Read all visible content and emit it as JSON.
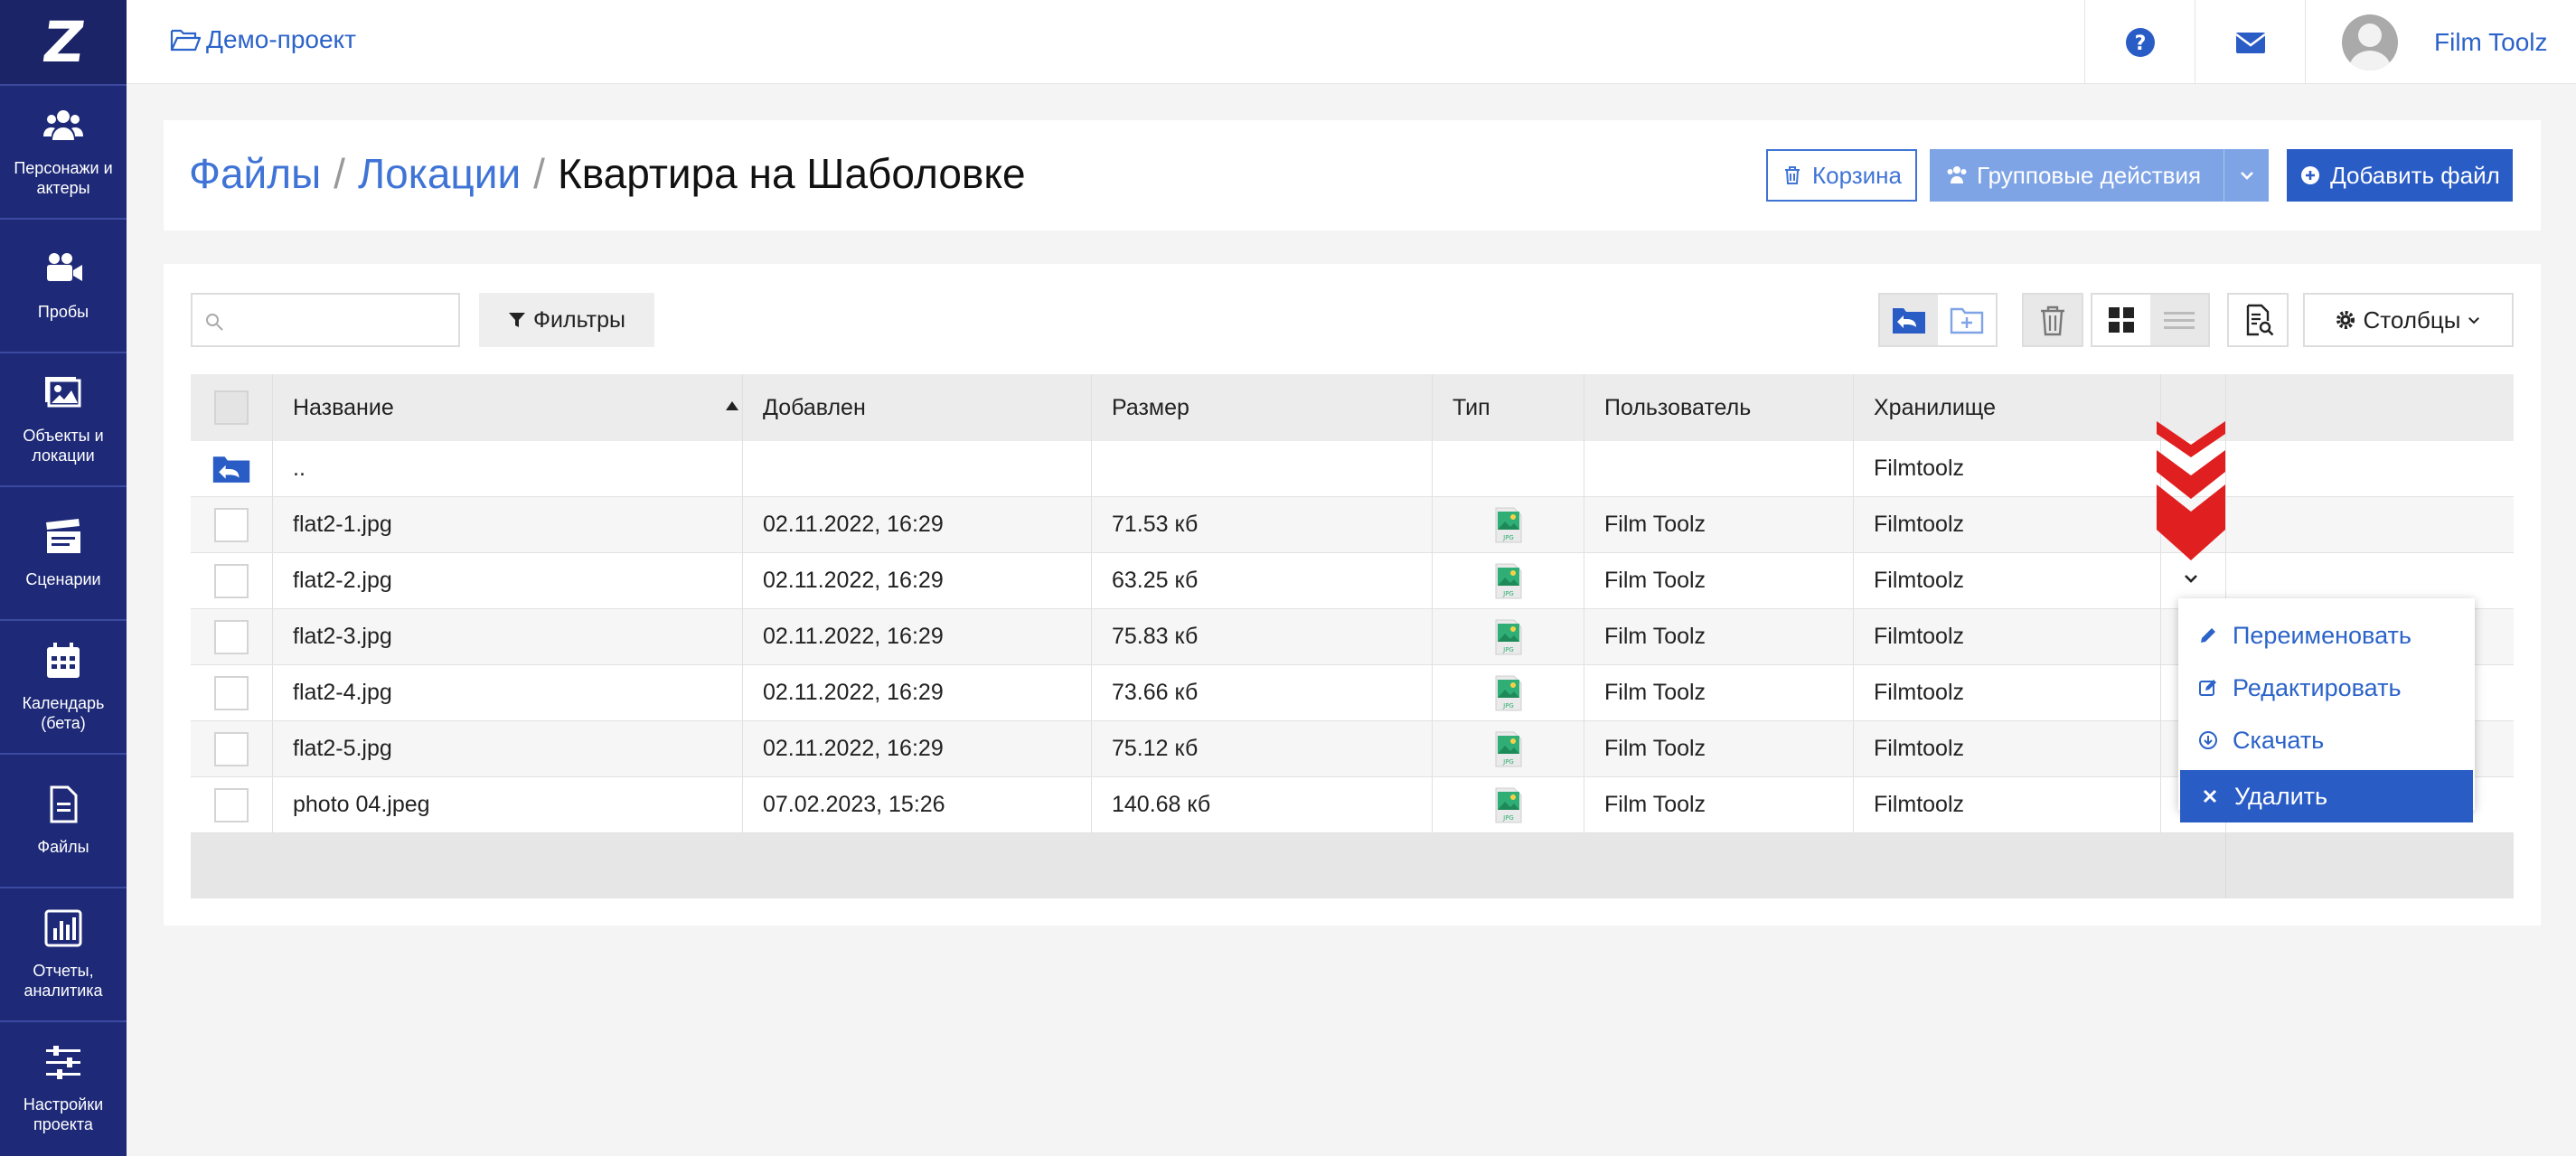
{
  "sidebar": {
    "logo": "Z",
    "items": [
      {
        "label": "Персонажи и\nактеры",
        "icon": "users-icon"
      },
      {
        "label": "Пробы",
        "icon": "video-camera-icon"
      },
      {
        "label": "Объекты и\nлокации",
        "icon": "image-icon"
      },
      {
        "label": "Сценарии",
        "icon": "clapperboard-icon"
      },
      {
        "label": "Календарь\n(бета)",
        "icon": "calendar-icon"
      },
      {
        "label": "Файлы",
        "icon": "file-icon"
      },
      {
        "label": "Отчеты,\nаналитика",
        "icon": "bar-chart-icon"
      },
      {
        "label": "Настройки\nпроекта",
        "icon": "sliders-icon"
      }
    ]
  },
  "topbar": {
    "project": "Демо-проект",
    "user_name": "Film Toolz"
  },
  "breadcrumb": {
    "level1": "Файлы",
    "level2": "Локации",
    "current": "Квартира на Шаболовке",
    "separator": "/"
  },
  "actions": {
    "trash_label": "Корзина",
    "group_label": "Групповые действия",
    "add_label": "Добавить файл"
  },
  "toolbar": {
    "search_placeholder": "",
    "filters_label": "Фильтры",
    "columns_label": "Столбцы"
  },
  "table": {
    "headers": {
      "name": "Название",
      "added": "Добавлен",
      "size": "Размер",
      "type": "Тип",
      "user": "Пользователь",
      "storage": "Хранилище"
    },
    "parent_row": {
      "name": "..",
      "storage": "Filmtoolz"
    },
    "rows": [
      {
        "name": "flat2-1.jpg",
        "added": "02.11.2022, 16:29",
        "size": "71.53 кб",
        "user": "Film Toolz",
        "storage": "Filmtoolz"
      },
      {
        "name": "flat2-2.jpg",
        "added": "02.11.2022, 16:29",
        "size": "63.25 кб",
        "user": "Film Toolz",
        "storage": "Filmtoolz"
      },
      {
        "name": "flat2-3.jpg",
        "added": "02.11.2022, 16:29",
        "size": "75.83 кб",
        "user": "Film Toolz",
        "storage": "Filmtoolz"
      },
      {
        "name": "flat2-4.jpg",
        "added": "02.11.2022, 16:29",
        "size": "73.66 кб",
        "user": "Film Toolz",
        "storage": "Filmtoolz"
      },
      {
        "name": "flat2-5.jpg",
        "added": "02.11.2022, 16:29",
        "size": "75.12 кб",
        "user": "Film Toolz",
        "storage": "Filmtoolz"
      },
      {
        "name": "photo 04.jpeg",
        "added": "07.02.2023, 15:26",
        "size": "140.68 кб",
        "user": "Film Toolz",
        "storage": "Filmtoolz"
      }
    ]
  },
  "context_menu": {
    "rename": "Переименовать",
    "edit": "Редактировать",
    "download": "Скачать",
    "delete": "Удалить"
  },
  "colors": {
    "sidebar_bg": "#1e2a78",
    "accent": "#2a5cc6",
    "link": "#3f74d6",
    "marker": "#e02020"
  }
}
